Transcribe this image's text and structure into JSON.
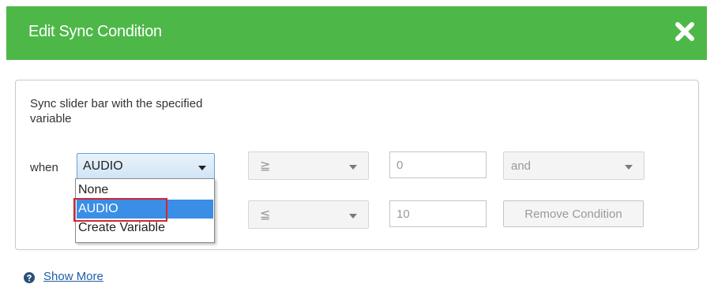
{
  "dialog": {
    "title": "Edit Sync Condition",
    "close_icon": "close-x-icon",
    "header_color": "#4db848"
  },
  "condition": {
    "description": "Sync slider bar with the specified variable",
    "when_label": "when",
    "variable": {
      "selected": "AUDIO",
      "options": [
        "None",
        "AUDIO",
        "Create Variable"
      ],
      "highlighted_option": "AUDIO"
    },
    "rows": [
      {
        "operator": "≧",
        "value": "0",
        "logic": "and"
      },
      {
        "operator": "≦",
        "value": "10",
        "action_label": "Remove Condition"
      }
    ]
  },
  "footer": {
    "help_icon": "question-circle-icon",
    "show_more": "Show More"
  },
  "colors": {
    "accent": "#4db848",
    "selection": "#3a8ee6",
    "highlight_border": "#d32530",
    "link": "#1f5fa8"
  }
}
